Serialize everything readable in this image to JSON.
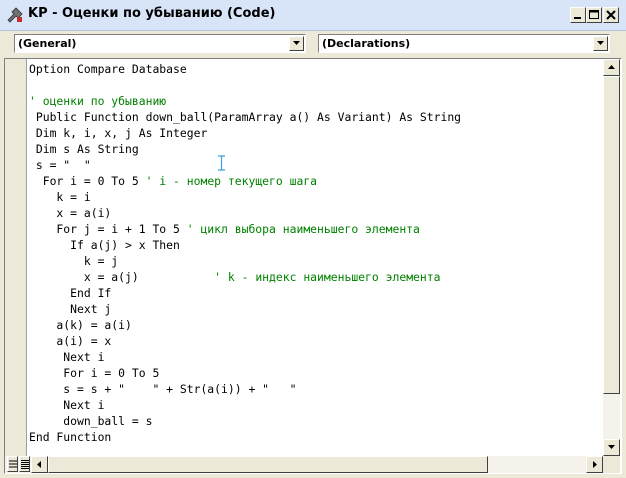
{
  "window": {
    "title": "KP - Оценки по убыванию (Code)"
  },
  "object_combo": {
    "selected": "(General)"
  },
  "procedure_combo": {
    "selected": "(Declarations)"
  },
  "code": {
    "lines": [
      {
        "text": "Option Compare Database"
      },
      {
        "text": ""
      },
      {
        "text": "' оценки по убыванию",
        "kind": "comment"
      },
      {
        "text": " Public Function down_ball(ParamArray a() As Variant) As String"
      },
      {
        "text": " Dim k, i, x, j As Integer"
      },
      {
        "text": " Dim s As String"
      },
      {
        "text": " s = \"  \""
      },
      {
        "text": "  For i = 0 To 5 ",
        "comment": "' i - номер текущего шага"
      },
      {
        "text": "    k = i"
      },
      {
        "text": "    x = a(i)"
      },
      {
        "text": "    For j = i + 1 To 5 ",
        "comment": "' цикл выбора наименьшего элемента"
      },
      {
        "text": "      If a(j) > x Then"
      },
      {
        "text": "        k = j"
      },
      {
        "text": "        x = a(j)           ",
        "comment": "' k - индекс наименьшего элемента"
      },
      {
        "text": "      End If"
      },
      {
        "text": "      Next j"
      },
      {
        "text": "    a(k) = a(i)"
      },
      {
        "text": "    a(i) = x"
      },
      {
        "text": "     Next i"
      },
      {
        "text": "     For i = 0 To 5"
      },
      {
        "text": "     s = s + \"    \" + Str(a(i)) + \"   \""
      },
      {
        "text": "     Next i"
      },
      {
        "text": "     down_ball = s"
      },
      {
        "text": "End Function"
      }
    ]
  },
  "colors": {
    "comment": "#008000",
    "text": "#000000",
    "cursor": "#3aa0e0"
  },
  "icons": {
    "title": "vba-module-icon",
    "minimize": "minimize-icon",
    "maximize": "maximize-icon",
    "close": "close-icon"
  }
}
